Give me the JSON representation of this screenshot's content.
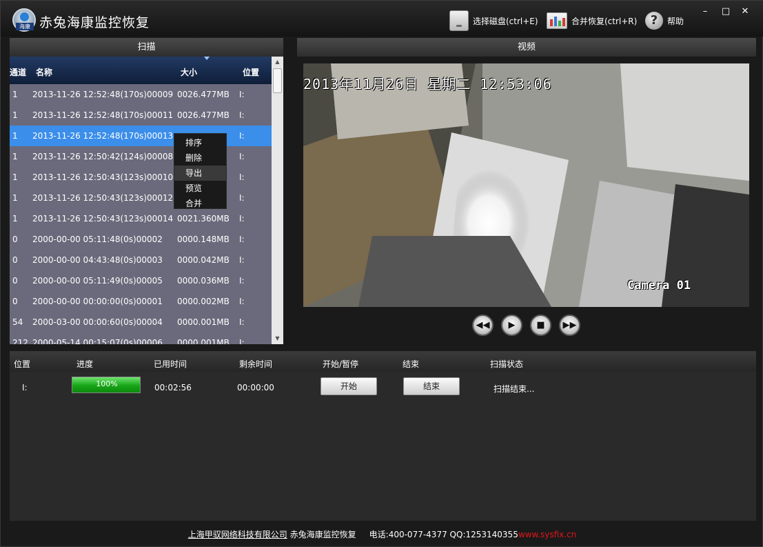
{
  "app": {
    "title": "赤兔海康监控恢复",
    "logo_text": "海康",
    "toolbar": {
      "select_disk": "选择磁盘(ctrl+E)",
      "merge_recover": "合并恢复(ctrl+R)",
      "help": "帮助"
    },
    "window_controls": {
      "minimize": "–",
      "maximize": "□",
      "close": "✕"
    }
  },
  "scan_panel": {
    "title": "扫描",
    "columns": {
      "channel": "通道",
      "name": "名称",
      "size": "大小",
      "position": "位置"
    },
    "rows": [
      {
        "channel": "1",
        "name": "2013-11-26 12:52:48(170s)00009",
        "size": "0026.477MB",
        "position": "I:"
      },
      {
        "channel": "1",
        "name": "2013-11-26 12:52:48(170s)00011",
        "size": "0026.477MB",
        "position": "I:"
      },
      {
        "channel": "1",
        "name": "2013-11-26 12:52:48(170s)00013",
        "size": "",
        "position": "I:"
      },
      {
        "channel": "1",
        "name": "2013-11-26 12:50:42(124s)00008",
        "size": "",
        "position": "I:"
      },
      {
        "channel": "1",
        "name": "2013-11-26 12:50:43(123s)00010",
        "size": "",
        "position": "I:"
      },
      {
        "channel": "1",
        "name": "2013-11-26 12:50:43(123s)00012",
        "size": "",
        "position": "I:"
      },
      {
        "channel": "1",
        "name": "2013-11-26 12:50:43(123s)00014",
        "size": "0021.360MB",
        "position": "I:"
      },
      {
        "channel": "0",
        "name": "2000-00-00 05:11:48(0s)00002",
        "size": "0000.148MB",
        "position": "I:"
      },
      {
        "channel": "0",
        "name": "2000-00-00 04:43:48(0s)00003",
        "size": "0000.042MB",
        "position": "I:"
      },
      {
        "channel": "0",
        "name": "2000-00-00 05:11:49(0s)00005",
        "size": "0000.036MB",
        "position": "I:"
      },
      {
        "channel": "0",
        "name": "2000-00-00 00:00:00(0s)00001",
        "size": "0000.002MB",
        "position": "I:"
      },
      {
        "channel": "54",
        "name": "2000-03-00 00:00:60(0s)00004",
        "size": "0000.001MB",
        "position": "I:"
      },
      {
        "channel": "212",
        "name": "2000-05-14 00:15:07(0s)00006",
        "size": "0000.001MB",
        "position": "I:"
      }
    ],
    "context_menu": [
      "排序",
      "删除",
      "导出",
      "预览",
      "合并"
    ]
  },
  "video_panel": {
    "title": "视频",
    "osd_time": "2013年11月26日 星期二 12:53:06",
    "osd_camera": "Camera 01"
  },
  "task_panel": {
    "columns": {
      "position": "位置",
      "progress": "进度",
      "elapsed": "已用时间",
      "remaining": "剩余时间",
      "start_pause": "开始/暂停",
      "end": "结束",
      "status": "扫描状态"
    },
    "row": {
      "position": "I:",
      "progress_value": 100,
      "progress_text": "100%",
      "elapsed": "00:02:56",
      "remaining": "00:00:00",
      "start_label": "开始",
      "end_label": "结束",
      "status": "扫描结束..."
    }
  },
  "footer": {
    "company": "上海甲驭网络科技有限公司",
    "product": "赤兔海康监控恢复",
    "phone": "电话:400-077-4377",
    "qq": "QQ:1253140355",
    "site": "www.sysfix.cn"
  }
}
